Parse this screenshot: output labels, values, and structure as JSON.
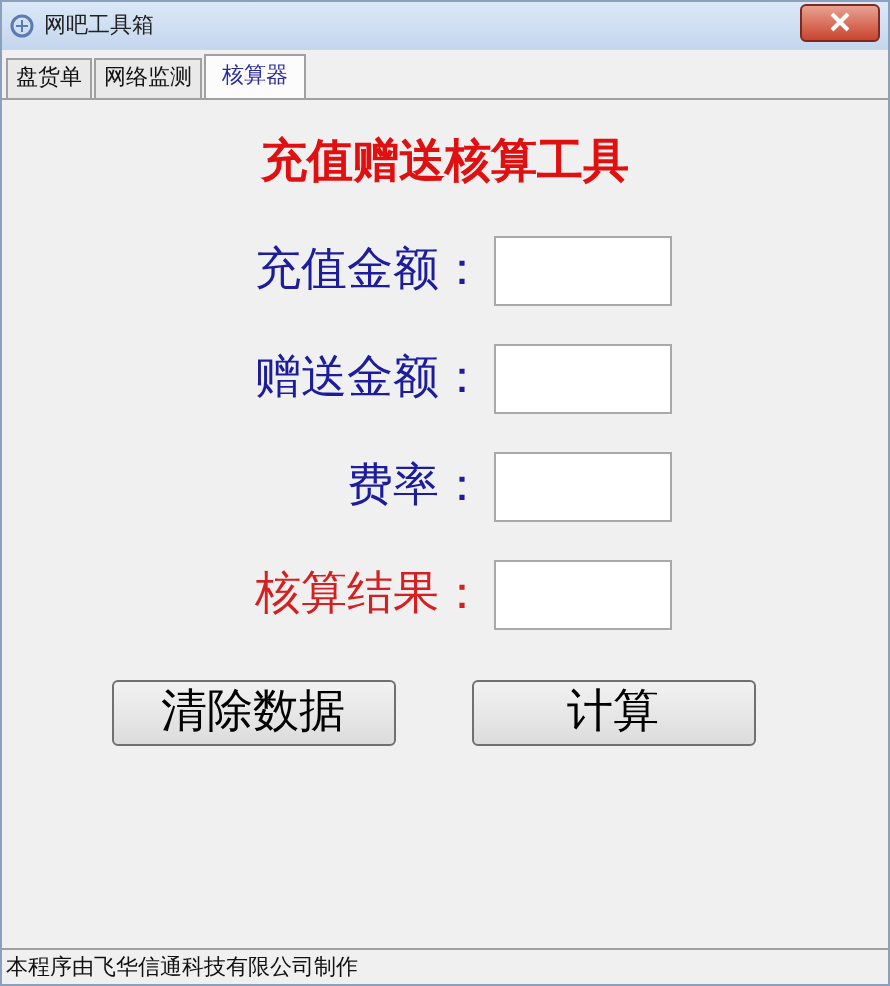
{
  "window": {
    "title": "网吧工具箱"
  },
  "tabs": [
    {
      "label": "盘货单",
      "selected": false
    },
    {
      "label": "网络监测",
      "selected": false
    },
    {
      "label": "核算器",
      "selected": true
    }
  ],
  "heading": "充值赠送核算工具",
  "fields": [
    {
      "label": "充值金额：",
      "color": "#1c1c9c"
    },
    {
      "label": "赠送金额：",
      "color": "#1c1c9c"
    },
    {
      "label": "费率：",
      "color": "#1c1c9c"
    },
    {
      "label": "核算结果：",
      "color": "#d42020"
    }
  ],
  "buttons": [
    "清除数据",
    "计算"
  ],
  "status_bar": "本程序由飞华信通科技有限公司制作"
}
